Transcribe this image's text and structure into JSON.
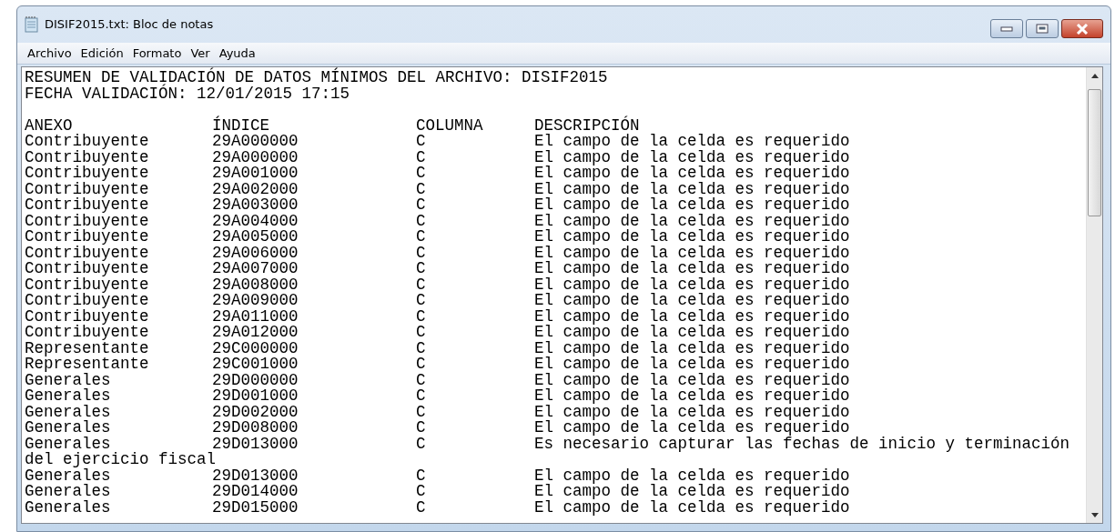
{
  "window": {
    "title": "DISIF2015.txt: Bloc de notas"
  },
  "menu": [
    "Archivo",
    "Edición",
    "Formato",
    "Ver",
    "Ayuda"
  ],
  "document": {
    "lines": [
      "RESUMEN DE VALIDACIÓN DE DATOS MÍNIMOS DEL ARCHIVO: DISIF2015",
      "FECHA VALIDACIÓN: 12/01/2015 17:15"
    ],
    "columns": [
      "ANEXO",
      "ÍNDICE",
      "COLUMNA",
      "DESCRIPCIÓN"
    ],
    "rows": [
      {
        "kind": "row",
        "cells": [
          "Contribuyente",
          "29A000000",
          "C",
          "El campo de la celda es requerido"
        ]
      },
      {
        "kind": "row",
        "cells": [
          "Contribuyente",
          "29A000000",
          "C",
          "El campo de la celda es requerido"
        ]
      },
      {
        "kind": "row",
        "cells": [
          "Contribuyente",
          "29A001000",
          "C",
          "El campo de la celda es requerido"
        ]
      },
      {
        "kind": "row",
        "cells": [
          "Contribuyente",
          "29A002000",
          "C",
          "El campo de la celda es requerido"
        ]
      },
      {
        "kind": "row",
        "cells": [
          "Contribuyente",
          "29A003000",
          "C",
          "El campo de la celda es requerido"
        ]
      },
      {
        "kind": "row",
        "cells": [
          "Contribuyente",
          "29A004000",
          "C",
          "El campo de la celda es requerido"
        ]
      },
      {
        "kind": "row",
        "cells": [
          "Contribuyente",
          "29A005000",
          "C",
          "El campo de la celda es requerido"
        ]
      },
      {
        "kind": "row",
        "cells": [
          "Contribuyente",
          "29A006000",
          "C",
          "El campo de la celda es requerido"
        ]
      },
      {
        "kind": "row",
        "cells": [
          "Contribuyente",
          "29A007000",
          "C",
          "El campo de la celda es requerido"
        ]
      },
      {
        "kind": "row",
        "cells": [
          "Contribuyente",
          "29A008000",
          "C",
          "El campo de la celda es requerido"
        ]
      },
      {
        "kind": "row",
        "cells": [
          "Contribuyente",
          "29A009000",
          "C",
          "El campo de la celda es requerido"
        ]
      },
      {
        "kind": "row",
        "cells": [
          "Contribuyente",
          "29A011000",
          "C",
          "El campo de la celda es requerido"
        ]
      },
      {
        "kind": "row",
        "cells": [
          "Contribuyente",
          "29A012000",
          "C",
          "El campo de la celda es requerido"
        ]
      },
      {
        "kind": "row",
        "cells": [
          "Representante",
          "29C000000",
          "C",
          "El campo de la celda es requerido"
        ]
      },
      {
        "kind": "row",
        "cells": [
          "Representante",
          "29C001000",
          "C",
          "El campo de la celda es requerido"
        ]
      },
      {
        "kind": "row",
        "cells": [
          "Generales",
          "29D000000",
          "C",
          "El campo de la celda es requerido"
        ]
      },
      {
        "kind": "row",
        "cells": [
          "Generales",
          "29D001000",
          "C",
          "El campo de la celda es requerido"
        ]
      },
      {
        "kind": "row",
        "cells": [
          "Generales",
          "29D002000",
          "C",
          "El campo de la celda es requerido"
        ]
      },
      {
        "kind": "row",
        "cells": [
          "Generales",
          "29D008000",
          "C",
          "El campo de la celda es requerido"
        ]
      },
      {
        "kind": "row",
        "cells": [
          "Generales",
          "29D013000",
          "C",
          "Es necesario capturar las fechas de inicio y terminación"
        ]
      },
      {
        "kind": "continuation",
        "text": "del ejercicio fiscal"
      },
      {
        "kind": "row",
        "cells": [
          "Generales",
          "29D013000",
          "C",
          "El campo de la celda es requerido"
        ]
      },
      {
        "kind": "row",
        "cells": [
          "Generales",
          "29D014000",
          "C",
          "El campo de la celda es requerido"
        ]
      },
      {
        "kind": "row",
        "cells": [
          "Generales",
          "29D015000",
          "C",
          "El campo de la celda es requerido"
        ]
      }
    ]
  }
}
